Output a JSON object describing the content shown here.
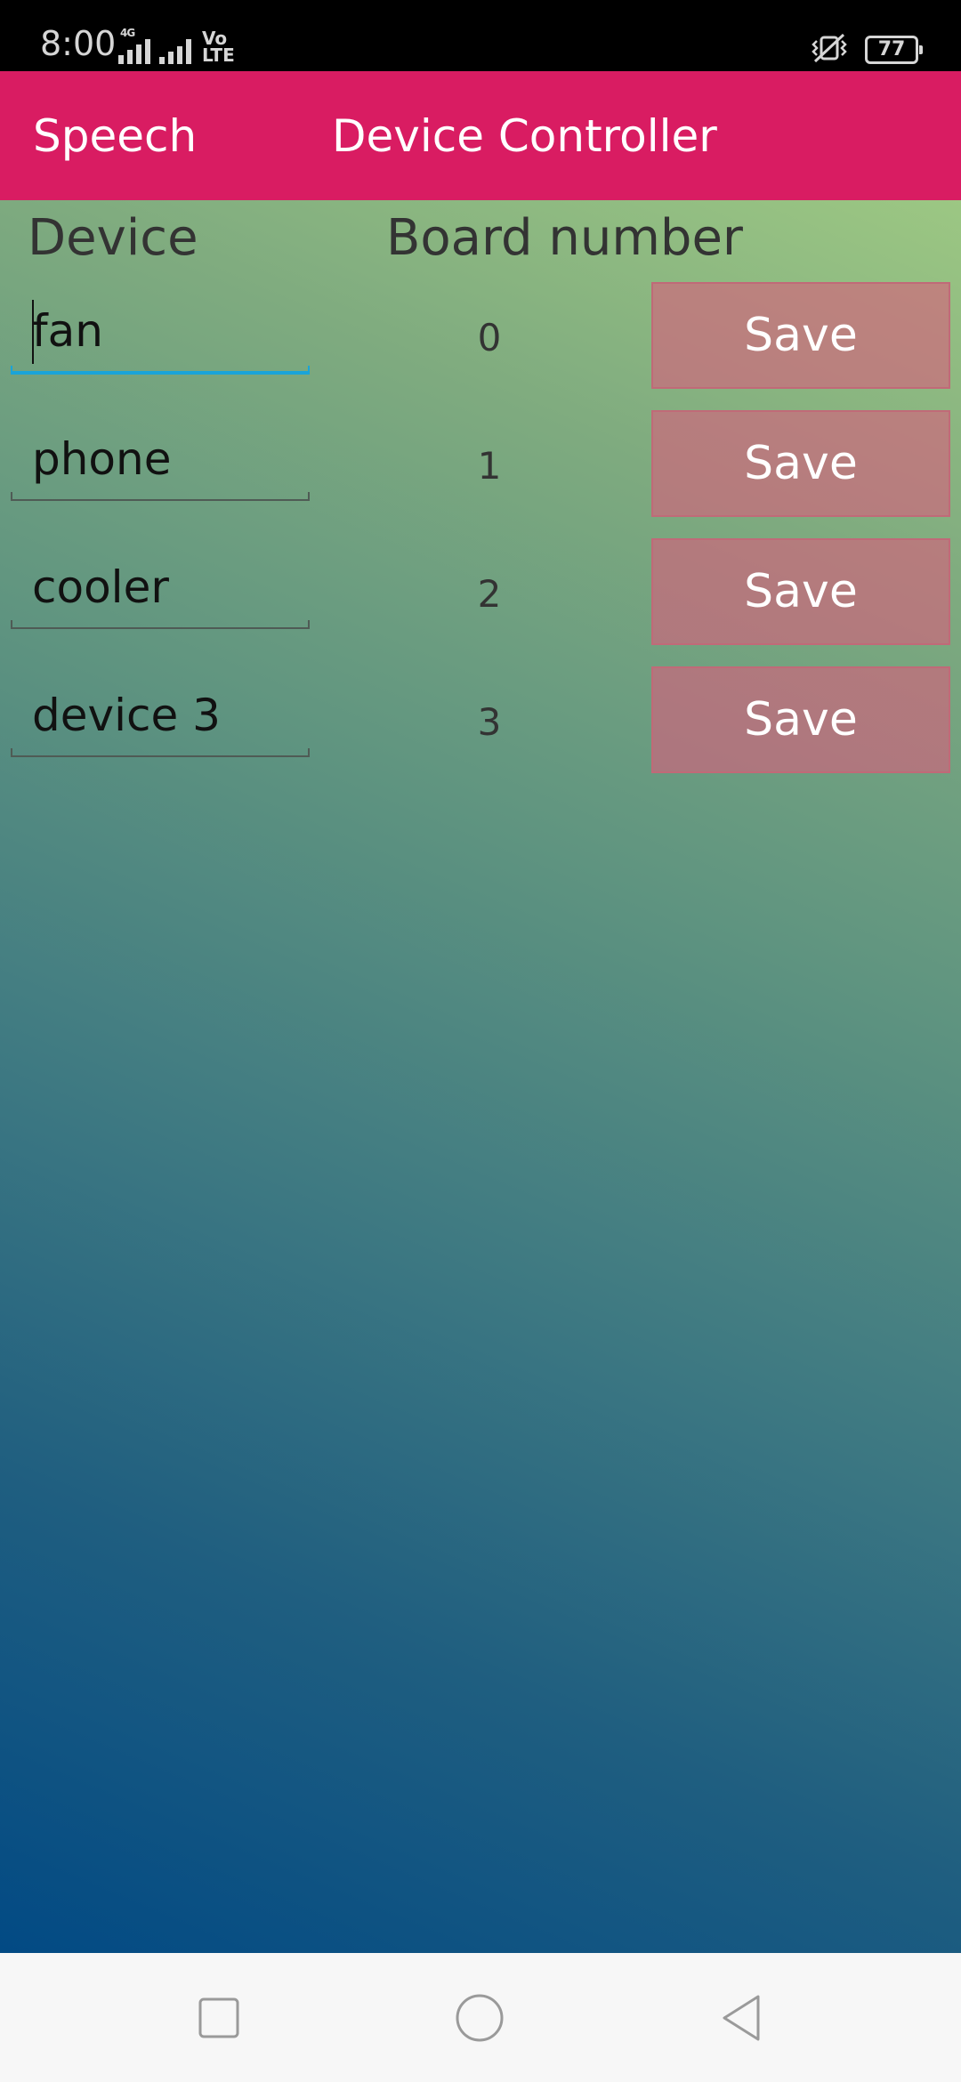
{
  "status_bar": {
    "time": "8:00",
    "network": "4G",
    "volte_top": "Vo",
    "volte_bottom": "LTE",
    "battery": "77",
    "icons": [
      "signal-icon",
      "signal-icon",
      "volte-icon",
      "vibrate-icon",
      "battery-icon"
    ]
  },
  "app_bar": {
    "tab_speech": "Speech",
    "tab_device": "Device Controller",
    "color": "#d91c62"
  },
  "table": {
    "header_device": "Device",
    "header_board": "Board number",
    "rows": [
      {
        "device": "fan",
        "board": "0",
        "save": "Save",
        "focused": true
      },
      {
        "device": "phone",
        "board": "1",
        "save": "Save",
        "focused": false
      },
      {
        "device": "cooler",
        "board": "2",
        "save": "Save",
        "focused": false
      },
      {
        "device": "device 3",
        "board": "3",
        "save": "Save",
        "focused": false
      }
    ]
  },
  "nav_bar": {
    "icons": [
      "recent-apps-icon",
      "home-icon",
      "back-icon"
    ]
  }
}
